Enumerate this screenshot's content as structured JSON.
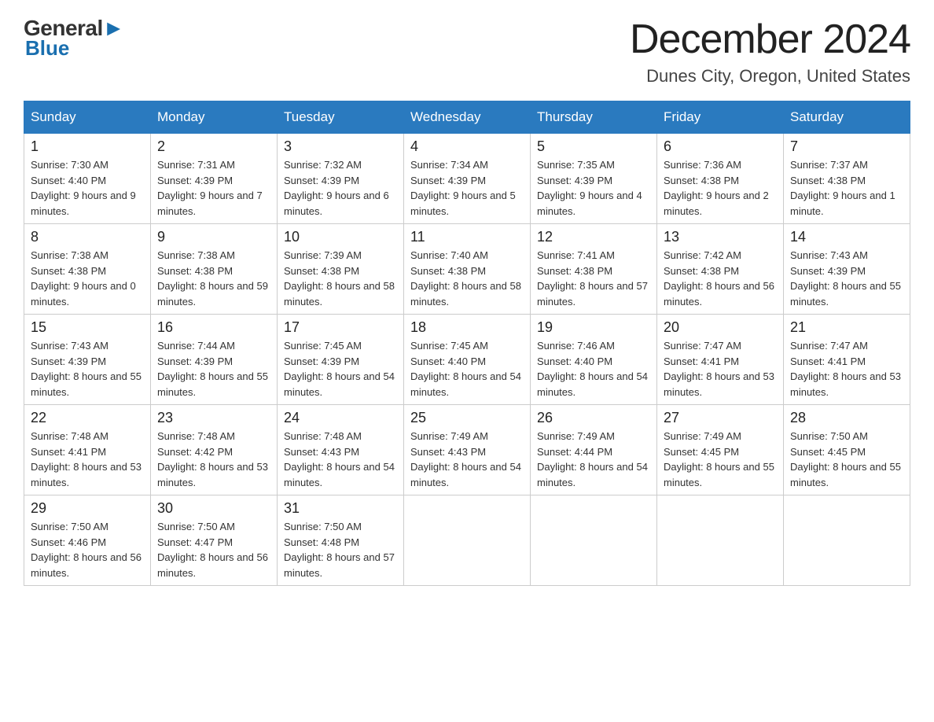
{
  "header": {
    "logo_general": "General",
    "logo_blue": "Blue",
    "month_title": "December 2024",
    "location": "Dunes City, Oregon, United States"
  },
  "days_of_week": [
    "Sunday",
    "Monday",
    "Tuesday",
    "Wednesday",
    "Thursday",
    "Friday",
    "Saturday"
  ],
  "weeks": [
    [
      {
        "day": "1",
        "sunrise": "7:30 AM",
        "sunset": "4:40 PM",
        "daylight": "9 hours and 9 minutes."
      },
      {
        "day": "2",
        "sunrise": "7:31 AM",
        "sunset": "4:39 PM",
        "daylight": "9 hours and 7 minutes."
      },
      {
        "day": "3",
        "sunrise": "7:32 AM",
        "sunset": "4:39 PM",
        "daylight": "9 hours and 6 minutes."
      },
      {
        "day": "4",
        "sunrise": "7:34 AM",
        "sunset": "4:39 PM",
        "daylight": "9 hours and 5 minutes."
      },
      {
        "day": "5",
        "sunrise": "7:35 AM",
        "sunset": "4:39 PM",
        "daylight": "9 hours and 4 minutes."
      },
      {
        "day": "6",
        "sunrise": "7:36 AM",
        "sunset": "4:38 PM",
        "daylight": "9 hours and 2 minutes."
      },
      {
        "day": "7",
        "sunrise": "7:37 AM",
        "sunset": "4:38 PM",
        "daylight": "9 hours and 1 minute."
      }
    ],
    [
      {
        "day": "8",
        "sunrise": "7:38 AM",
        "sunset": "4:38 PM",
        "daylight": "9 hours and 0 minutes."
      },
      {
        "day": "9",
        "sunrise": "7:38 AM",
        "sunset": "4:38 PM",
        "daylight": "8 hours and 59 minutes."
      },
      {
        "day": "10",
        "sunrise": "7:39 AM",
        "sunset": "4:38 PM",
        "daylight": "8 hours and 58 minutes."
      },
      {
        "day": "11",
        "sunrise": "7:40 AM",
        "sunset": "4:38 PM",
        "daylight": "8 hours and 58 minutes."
      },
      {
        "day": "12",
        "sunrise": "7:41 AM",
        "sunset": "4:38 PM",
        "daylight": "8 hours and 57 minutes."
      },
      {
        "day": "13",
        "sunrise": "7:42 AM",
        "sunset": "4:38 PM",
        "daylight": "8 hours and 56 minutes."
      },
      {
        "day": "14",
        "sunrise": "7:43 AM",
        "sunset": "4:39 PM",
        "daylight": "8 hours and 55 minutes."
      }
    ],
    [
      {
        "day": "15",
        "sunrise": "7:43 AM",
        "sunset": "4:39 PM",
        "daylight": "8 hours and 55 minutes."
      },
      {
        "day": "16",
        "sunrise": "7:44 AM",
        "sunset": "4:39 PM",
        "daylight": "8 hours and 55 minutes."
      },
      {
        "day": "17",
        "sunrise": "7:45 AM",
        "sunset": "4:39 PM",
        "daylight": "8 hours and 54 minutes."
      },
      {
        "day": "18",
        "sunrise": "7:45 AM",
        "sunset": "4:40 PM",
        "daylight": "8 hours and 54 minutes."
      },
      {
        "day": "19",
        "sunrise": "7:46 AM",
        "sunset": "4:40 PM",
        "daylight": "8 hours and 54 minutes."
      },
      {
        "day": "20",
        "sunrise": "7:47 AM",
        "sunset": "4:41 PM",
        "daylight": "8 hours and 53 minutes."
      },
      {
        "day": "21",
        "sunrise": "7:47 AM",
        "sunset": "4:41 PM",
        "daylight": "8 hours and 53 minutes."
      }
    ],
    [
      {
        "day": "22",
        "sunrise": "7:48 AM",
        "sunset": "4:41 PM",
        "daylight": "8 hours and 53 minutes."
      },
      {
        "day": "23",
        "sunrise": "7:48 AM",
        "sunset": "4:42 PM",
        "daylight": "8 hours and 53 minutes."
      },
      {
        "day": "24",
        "sunrise": "7:48 AM",
        "sunset": "4:43 PM",
        "daylight": "8 hours and 54 minutes."
      },
      {
        "day": "25",
        "sunrise": "7:49 AM",
        "sunset": "4:43 PM",
        "daylight": "8 hours and 54 minutes."
      },
      {
        "day": "26",
        "sunrise": "7:49 AM",
        "sunset": "4:44 PM",
        "daylight": "8 hours and 54 minutes."
      },
      {
        "day": "27",
        "sunrise": "7:49 AM",
        "sunset": "4:45 PM",
        "daylight": "8 hours and 55 minutes."
      },
      {
        "day": "28",
        "sunrise": "7:50 AM",
        "sunset": "4:45 PM",
        "daylight": "8 hours and 55 minutes."
      }
    ],
    [
      {
        "day": "29",
        "sunrise": "7:50 AM",
        "sunset": "4:46 PM",
        "daylight": "8 hours and 56 minutes."
      },
      {
        "day": "30",
        "sunrise": "7:50 AM",
        "sunset": "4:47 PM",
        "daylight": "8 hours and 56 minutes."
      },
      {
        "day": "31",
        "sunrise": "7:50 AM",
        "sunset": "4:48 PM",
        "daylight": "8 hours and 57 minutes."
      },
      null,
      null,
      null,
      null
    ]
  ]
}
